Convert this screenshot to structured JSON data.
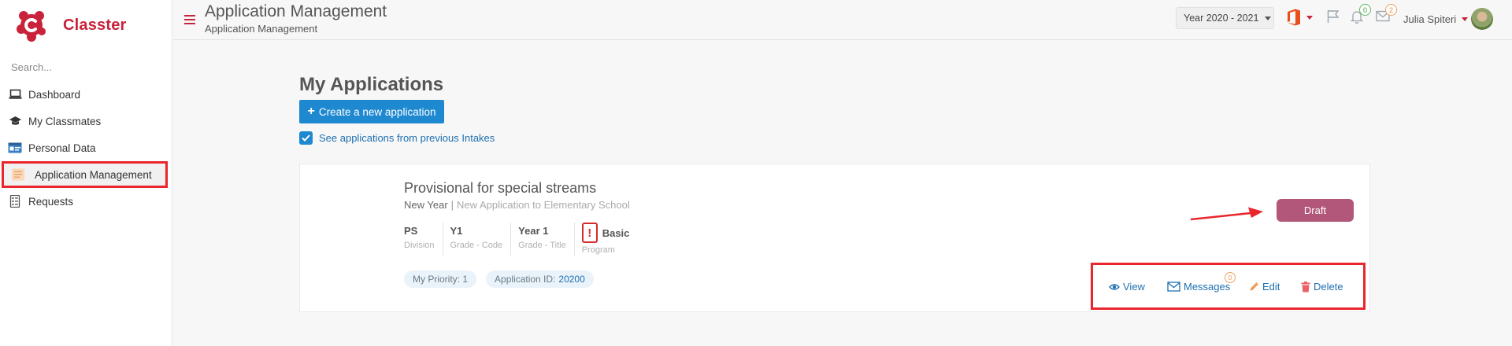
{
  "sidebar": {
    "brand_name": "Classter",
    "search_placeholder": "Search...",
    "items": [
      {
        "label": "Dashboard",
        "icon": "laptop-icon"
      },
      {
        "label": "My Classmates",
        "icon": "graduation-cap-icon"
      },
      {
        "label": "Personal Data",
        "icon": "id-card-icon"
      },
      {
        "label": "Application Management",
        "icon": "application-form-icon",
        "active": true
      },
      {
        "label": "Requests",
        "icon": "requests-list-icon"
      }
    ]
  },
  "header": {
    "title": "Application Management",
    "subtitle": "Application Management",
    "year_select": "Year 2020 - 2021",
    "notifications_count": "0",
    "messages_count": "2",
    "user_name": "Julia Spiteri"
  },
  "main": {
    "title": "My Applications",
    "create_button": "Create a new application",
    "checkbox_label": "See applications from previous Intakes",
    "checkbox_checked": true
  },
  "application": {
    "name": "Provisional for special streams",
    "intake": "New Year",
    "separator": "|",
    "description": "New Application to Elementary School",
    "fields": [
      {
        "value": "PS",
        "label": "Division"
      },
      {
        "value": "Y1",
        "label": "Grade - Code"
      },
      {
        "value": "Year 1",
        "label": "Grade - Title"
      }
    ],
    "program": {
      "value": "Basic",
      "label": "Program",
      "warning": "!"
    },
    "priority_chip": "My Priority: 1",
    "app_id_label": "Application ID:",
    "app_id_value": "20200",
    "status": "Draft",
    "actions": {
      "view": "View",
      "messages": "Messages",
      "messages_count": "0",
      "edit": "Edit",
      "delete": "Delete"
    }
  },
  "colors": {
    "brand": "#c8233a",
    "primary": "#1e88d0",
    "draft": "#b2577a",
    "highlight": "#e8262c"
  }
}
